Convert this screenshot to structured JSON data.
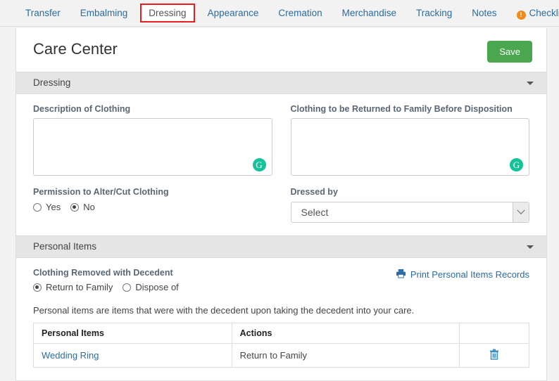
{
  "tabs": [
    {
      "label": "Transfer",
      "active": false,
      "icon": null
    },
    {
      "label": "Embalming",
      "active": false,
      "icon": null
    },
    {
      "label": "Dressing",
      "active": true,
      "icon": null
    },
    {
      "label": "Appearance",
      "active": false,
      "icon": null
    },
    {
      "label": "Cremation",
      "active": false,
      "icon": null
    },
    {
      "label": "Merchandise",
      "active": false,
      "icon": null
    },
    {
      "label": "Tracking",
      "active": false,
      "icon": null
    },
    {
      "label": "Notes",
      "active": false,
      "icon": null
    },
    {
      "label": "Checklists",
      "active": false,
      "icon": "alert-circle-icon"
    }
  ],
  "header": {
    "title": "Care Center",
    "save_label": "Save"
  },
  "sections": {
    "dressing": {
      "title": "Dressing",
      "description_of_clothing": {
        "label": "Description of Clothing",
        "value": "",
        "placeholder": "",
        "assistant_icon": "grammarly-icon",
        "assistant_glyph": "G"
      },
      "clothing_returned": {
        "label": "Clothing to be Returned to Family Before Disposition",
        "value": "",
        "placeholder": "",
        "assistant_icon": "grammarly-icon",
        "assistant_glyph": "G"
      },
      "permission_to_alter": {
        "label": "Permission to Alter/Cut Clothing",
        "options": [
          {
            "label": "Yes",
            "selected": false
          },
          {
            "label": "No",
            "selected": true
          }
        ]
      },
      "dressed_by": {
        "label": "Dressed by",
        "selected": "Select",
        "options": [
          "Select"
        ]
      }
    },
    "personal_items": {
      "title": "Personal Items",
      "clothing_removed": {
        "label": "Clothing Removed with Decedent",
        "options": [
          {
            "label": "Return to Family",
            "selected": true
          },
          {
            "label": "Dispose of",
            "selected": false
          }
        ]
      },
      "print_link": {
        "label": "Print Personal Items Records",
        "icon": "printer-icon"
      },
      "helper_text": "Personal items are items that were with the decedent upon taking the decedent into your care.",
      "table": {
        "columns": [
          "Personal Items",
          "Actions",
          ""
        ],
        "rows": [
          {
            "name": "Wedding Ring",
            "action": "Return to Family",
            "delete_icon": "trash-icon"
          }
        ]
      }
    }
  },
  "colors": {
    "accent_link": "#2b6ca3",
    "save_green": "#4aa64f",
    "active_tab_outline": "#e81d1d",
    "alert_orange": "#f18a1b",
    "grammarly_green": "#15c39a",
    "section_header_bg": "#e5e5e5",
    "page_bg": "#f2f2f2"
  }
}
